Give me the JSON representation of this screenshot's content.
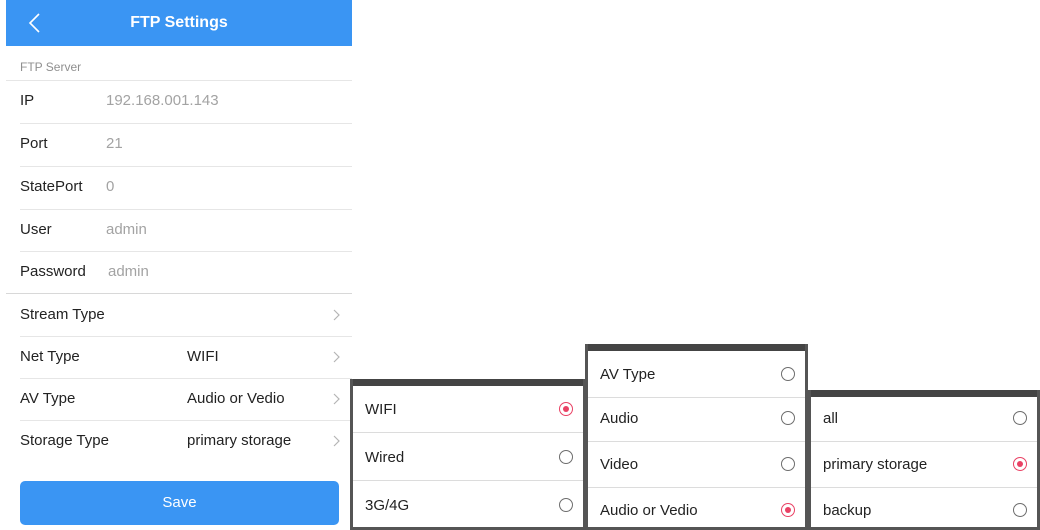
{
  "header": {
    "title": "FTP Settings"
  },
  "ftp_server": {
    "section_label": "FTP Server",
    "fields": [
      {
        "label": "IP",
        "value": "192.168.001.143"
      },
      {
        "label": "Port",
        "value": "21"
      },
      {
        "label": "StatePort",
        "value": "0"
      },
      {
        "label": "User",
        "value": "admin"
      },
      {
        "label": "Password",
        "value": "admin"
      }
    ]
  },
  "selectors": [
    {
      "label": "Stream Type",
      "value": ""
    },
    {
      "label": "Net Type",
      "value": "WIFI"
    },
    {
      "label": "AV Type",
      "value": "Audio or Vedio"
    },
    {
      "label": "Storage Type",
      "value": "primary storage"
    }
  ],
  "save_label": "Save",
  "popups": {
    "net_type": {
      "options": [
        {
          "label": "WIFI",
          "selected": true
        },
        {
          "label": "Wired",
          "selected": false
        },
        {
          "label": "3G/4G",
          "selected": false
        }
      ]
    },
    "av_type": {
      "options": [
        {
          "label": "AV Type",
          "selected": false
        },
        {
          "label": "Audio",
          "selected": false
        },
        {
          "label": "Video",
          "selected": false
        },
        {
          "label": "Audio or Vedio",
          "selected": true
        }
      ]
    },
    "storage_type": {
      "options": [
        {
          "label": "all",
          "selected": false
        },
        {
          "label": "primary storage",
          "selected": true
        },
        {
          "label": "backup",
          "selected": false
        }
      ]
    }
  },
  "colors": {
    "accent": "#3a95f3",
    "radio_selected": "#e94164"
  }
}
